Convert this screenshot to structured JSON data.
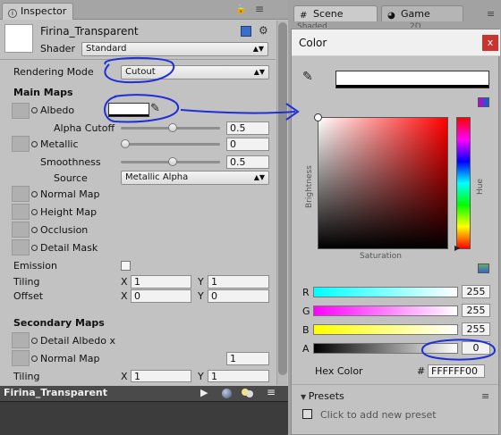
{
  "inspector": {
    "tab_label": "Inspector",
    "material_name": "Firina_Transparent",
    "shader_label": "Shader",
    "shader_value": "Standard",
    "rendering_mode_label": "Rendering Mode",
    "rendering_mode_value": "Cutout",
    "main_maps_header": "Main Maps",
    "albedo_label": "Albedo",
    "alpha_cutoff_label": "Alpha Cutoff",
    "alpha_cutoff_value": "0.5",
    "alpha_cutoff_fraction": 0.5,
    "metallic_label": "Metallic",
    "metallic_value": "0",
    "metallic_fraction": 0,
    "smoothness_label": "Smoothness",
    "smoothness_value": "0.5",
    "smoothness_fraction": 0.5,
    "source_label": "Source",
    "source_value": "Metallic Alpha",
    "normal_map_label": "Normal Map",
    "height_map_label": "Height Map",
    "occlusion_label": "Occlusion",
    "detail_mask_label": "Detail Mask",
    "emission_label": "Emission",
    "emission_checked": false,
    "tiling_label": "Tiling",
    "tiling_x": "1",
    "tiling_y": "1",
    "offset_label": "Offset",
    "offset_x": "0",
    "offset_y": "0",
    "axis_x": "X",
    "axis_y": "Y",
    "secondary_maps_header": "Secondary Maps",
    "detail_albedo_label": "Detail Albedo x",
    "sec_normal_map_label": "Normal Map",
    "sec_normal_map_value": "1",
    "sec_tiling_label": "Tiling",
    "sec_tiling_x": "1",
    "sec_tiling_y": "1",
    "preview_title": "Firina_Transparent"
  },
  "scene_tabs": {
    "scene_label": "Scene",
    "game_label": "Game",
    "shaded_label": "Shaded",
    "mode_2d_label": "2D"
  },
  "color_window": {
    "title": "Color",
    "close_glyph": "x",
    "brightness_label": "Brightness",
    "saturation_label": "Saturation",
    "hue_label": "Hue",
    "r_label": "R",
    "g_label": "G",
    "b_label": "B",
    "a_label": "A",
    "r_value": "255",
    "g_value": "255",
    "b_value": "255",
    "a_value": "0",
    "hex_label": "Hex Color",
    "hex_hash": "#",
    "hex_value": "FFFFFF00",
    "presets_label": "Presets",
    "add_preset_label": "Click to add new preset"
  },
  "colors": {
    "panel_bg": "#c2c2c2",
    "annotation_blue": "#1f2fd8",
    "close_red": "#c9352e"
  }
}
